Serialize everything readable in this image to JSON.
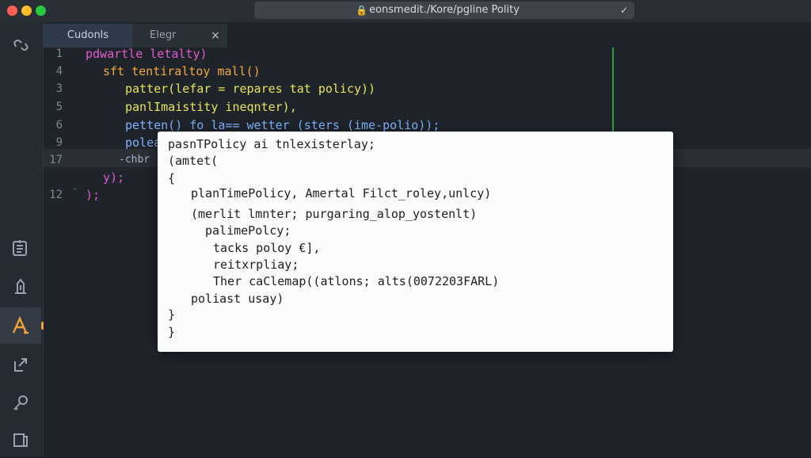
{
  "titlebar": {
    "url": "eonsmedit./Kore/pgline Polity"
  },
  "tabs": [
    {
      "label": "Cudonls"
    },
    {
      "label": "Elegr"
    }
  ],
  "tab_close_label": "×",
  "editor": {
    "line_numbers": [
      "1",
      "4",
      "3",
      "5",
      "6",
      "9",
      "17",
      "12"
    ],
    "lines": [
      {
        "text": "pdwartle letalty)",
        "color": "#e05bd0"
      },
      {
        "text": "sft tentiraltoy mall()",
        "color": "#f1a93b"
      },
      {
        "text": "patter(lefar = repares tat policy))",
        "color": "#e8e45a"
      },
      {
        "text": "panlImaistity ineqnter),",
        "color": "#e8e45a"
      },
      {
        "text": "petten() fo la== wetter (sters (ime-polio));",
        "color": "#7fb3ff"
      },
      {
        "text": "polea",
        "color": "#7fb3ff"
      },
      {
        "text": "-chbr",
        "color": "#9fb4c8"
      },
      {
        "text": "y);",
        "color": "#e05bd0"
      },
      {
        "text": ");",
        "color": "#e05bd0"
      }
    ]
  },
  "popup": {
    "lines": [
      "pasnTPolicy ai tnlexisterlay;",
      "(amtet(",
      "{",
      "planTimePolicy, Amertal Filct_roley,unlcy)",
      "(merlit lmnter; purgaring_alop_yostenlt)",
      "palimePolcy;",
      "tacks poloy €],",
      "reitxrpliay;",
      "Ther caClemap((atlons; alts(0072203FARL)",
      "poliast usay)",
      "}",
      "}"
    ]
  },
  "colors": {
    "background": "#1f242b",
    "accent_active": "#f0a23a",
    "ruler": "#2f9e44"
  }
}
